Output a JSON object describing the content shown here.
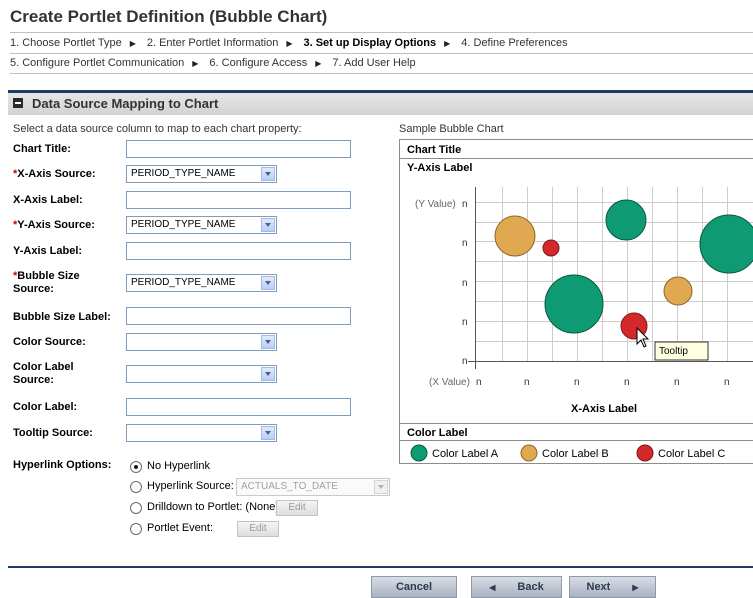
{
  "page": {
    "title": "Create Portlet Definition (Bubble Chart)"
  },
  "steps_row1": [
    {
      "label": "1. Choose Portlet Type",
      "current": false
    },
    {
      "label": "2. Enter Portlet Information",
      "current": false
    },
    {
      "label": "3. Set up Display Options",
      "current": true
    },
    {
      "label": "4. Define Preferences",
      "current": false
    }
  ],
  "steps_row2": [
    {
      "label": "5. Configure Portlet Communication",
      "current": false
    },
    {
      "label": "6. Configure Access",
      "current": false
    },
    {
      "label": "7. Add User Help",
      "current": false
    }
  ],
  "section": {
    "title": "Data Source Mapping to Chart",
    "instructions": "Select a data source column to map to each chart property:",
    "sample_label": "Sample Bubble Chart"
  },
  "form": {
    "chart_title": {
      "label": "Chart Title:",
      "value": ""
    },
    "x_axis_source": {
      "required": "*",
      "label": "X-Axis Source:",
      "value": "PERIOD_TYPE_NAME"
    },
    "x_axis_label": {
      "label": "X-Axis Label:",
      "value": ""
    },
    "y_axis_source": {
      "required": "*",
      "label": "Y-Axis Source:",
      "value": "PERIOD_TYPE_NAME"
    },
    "y_axis_label": {
      "label": "Y-Axis Label:",
      "value": ""
    },
    "bubble_size_source": {
      "required": "*",
      "label_line1": "Bubble Size",
      "label_line2": "Source:",
      "value": "PERIOD_TYPE_NAME"
    },
    "bubble_size_label": {
      "label": "Bubble Size Label:",
      "value": ""
    },
    "color_source": {
      "label": "Color Source:",
      "value": ""
    },
    "color_label_source": {
      "label_line1": "Color Label",
      "label_line2": "Source:",
      "value": ""
    },
    "color_label": {
      "label": "Color Label:",
      "value": ""
    },
    "tooltip_source": {
      "label": "Tooltip Source:",
      "value": ""
    },
    "hyperlink": {
      "label": "Hyperlink Options:",
      "selected": "no_hyperlink",
      "no_hyperlink": "No Hyperlink",
      "hyperlink_source": "Hyperlink Source:",
      "hyperlink_source_value": "ACTUALS_TO_DATE",
      "drilldown": "Drilldown to Portlet: (None)",
      "portlet_event": "Portlet Event:",
      "edit": "Edit"
    }
  },
  "sample_chart": {
    "chart_title": "Chart Title",
    "y_axis_label": "Y-Axis Label",
    "x_axis_label": "X-Axis Label",
    "y_value_label": "(Y Value)",
    "x_value_label": "(X Value)",
    "tick": "n",
    "tooltip": "Tooltip",
    "color_label_header": "Color Label",
    "legend": [
      {
        "label": "Color Label A",
        "color": "#0e9a72"
      },
      {
        "label": "Color Label B",
        "color": "#e0a850"
      },
      {
        "label": "Color Label C",
        "color": "#d4282b"
      }
    ]
  },
  "buttons": {
    "cancel": "Cancel",
    "back": "Back",
    "next": "Next"
  }
}
